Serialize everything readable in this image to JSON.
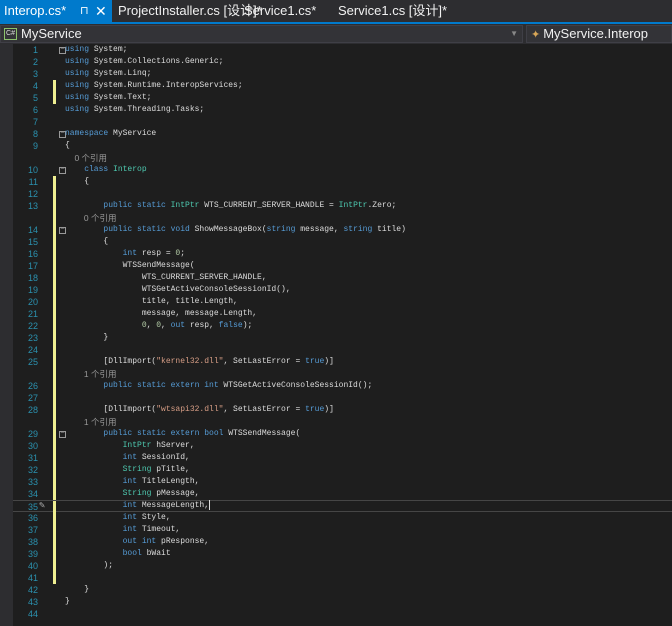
{
  "tabs": [
    {
      "label": "Interop.cs*",
      "active": true
    },
    {
      "label": "ProjectInstaller.cs [设计]*"
    },
    {
      "label": "Service1.cs*"
    },
    {
      "label": "Service1.cs [设计]*"
    }
  ],
  "tab_icons": {
    "pin": "⊓",
    "close": "✕"
  },
  "nav": {
    "project": "MyService",
    "project_icon": "C#",
    "member": "MyService.Interop"
  },
  "colors": {
    "accent": "#007acc",
    "keyword": "#569cd6",
    "type": "#4ec9b0",
    "string": "#d69d85",
    "line_number": "#2b91af"
  },
  "code": {
    "rows": [
      {
        "n": "1",
        "f": 1,
        "tk": [
          [
            "using",
            "k"
          ],
          [
            " System;",
            "p"
          ]
        ]
      },
      {
        "n": "2",
        "tk": [
          [
            "using",
            "k"
          ],
          [
            " System.Collections.Generic;",
            "p"
          ]
        ]
      },
      {
        "n": "3",
        "tk": [
          [
            "using",
            "k"
          ],
          [
            " System.Linq;",
            "p"
          ]
        ]
      },
      {
        "n": "4",
        "c": 1,
        "tk": [
          [
            "using",
            "k"
          ],
          [
            " System.Runtime.InteropServices;",
            "p"
          ]
        ]
      },
      {
        "n": "5",
        "c": 1,
        "tk": [
          [
            "using",
            "k"
          ],
          [
            " System.Text;",
            "p"
          ]
        ]
      },
      {
        "n": "6",
        "tk": [
          [
            "using",
            "k"
          ],
          [
            " System.Threading.Tasks;",
            "p"
          ]
        ]
      },
      {
        "n": "7",
        "tk": []
      },
      {
        "n": "8",
        "f": 1,
        "tk": [
          [
            "namespace",
            "k"
          ],
          [
            " MyService",
            "p"
          ]
        ]
      },
      {
        "n": "9",
        "tk": [
          [
            "{",
            "p"
          ]
        ]
      },
      {
        "n": "",
        "lens": "    0 个引用"
      },
      {
        "n": "10",
        "f": 1,
        "tk": [
          [
            "    class ",
            "k"
          ],
          [
            "Interop",
            "t"
          ]
        ]
      },
      {
        "n": "11",
        "c": 1,
        "tk": [
          [
            "    {",
            "p"
          ]
        ]
      },
      {
        "n": "12",
        "c": 1,
        "tk": []
      },
      {
        "n": "13",
        "c": 1,
        "tk": [
          [
            "        public static ",
            "k"
          ],
          [
            "IntPtr",
            "t"
          ],
          [
            " WTS_CURRENT_SERVER_HANDLE = ",
            "p"
          ],
          [
            "IntPtr",
            "t"
          ],
          [
            ".Zero;",
            "p"
          ]
        ]
      },
      {
        "n": "",
        "c": 1,
        "lens": "        0 个引用"
      },
      {
        "n": "14",
        "c": 1,
        "f": 1,
        "tk": [
          [
            "        public static void",
            "k"
          ],
          [
            " ShowMessageBox(",
            "p"
          ],
          [
            "string",
            "k"
          ],
          [
            " message, ",
            "p"
          ],
          [
            "string",
            "k"
          ],
          [
            " title)",
            "p"
          ]
        ]
      },
      {
        "n": "15",
        "c": 1,
        "tk": [
          [
            "        {",
            "p"
          ]
        ]
      },
      {
        "n": "16",
        "c": 1,
        "tk": [
          [
            "            int",
            "k"
          ],
          [
            " resp = ",
            "p"
          ],
          [
            "0",
            "n"
          ],
          [
            ";",
            "p"
          ]
        ]
      },
      {
        "n": "17",
        "c": 1,
        "tk": [
          [
            "            WTSSendMessage(",
            "p"
          ]
        ]
      },
      {
        "n": "18",
        "c": 1,
        "tk": [
          [
            "                WTS_CURRENT_SERVER_HANDLE,",
            "p"
          ]
        ]
      },
      {
        "n": "19",
        "c": 1,
        "tk": [
          [
            "                WTSGetActiveConsoleSessionId(),",
            "p"
          ]
        ]
      },
      {
        "n": "20",
        "c": 1,
        "tk": [
          [
            "                title, title.Length,",
            "p"
          ]
        ]
      },
      {
        "n": "21",
        "c": 1,
        "tk": [
          [
            "                message, message.Length,",
            "p"
          ]
        ]
      },
      {
        "n": "22",
        "c": 1,
        "tk": [
          [
            "                ",
            "p"
          ],
          [
            "0",
            "n"
          ],
          [
            ", ",
            "p"
          ],
          [
            "0",
            "n"
          ],
          [
            ", ",
            "p"
          ],
          [
            "out",
            "k"
          ],
          [
            " resp, ",
            "p"
          ],
          [
            "false",
            "k"
          ],
          [
            ");",
            "p"
          ]
        ]
      },
      {
        "n": "23",
        "c": 1,
        "tk": [
          [
            "        }",
            "p"
          ]
        ]
      },
      {
        "n": "24",
        "c": 1,
        "tk": []
      },
      {
        "n": "25",
        "c": 1,
        "tk": [
          [
            "        [DllImport(",
            "p"
          ],
          [
            "\"kernel32.dll\"",
            "s"
          ],
          [
            ", SetLastError = ",
            "p"
          ],
          [
            "true",
            "k"
          ],
          [
            ")]",
            "p"
          ]
        ]
      },
      {
        "n": "",
        "c": 1,
        "lens": "        1 个引用"
      },
      {
        "n": "26",
        "c": 1,
        "tk": [
          [
            "        public static extern int",
            "k"
          ],
          [
            " WTSGetActiveConsoleSessionId();",
            "p"
          ]
        ]
      },
      {
        "n": "27",
        "c": 1,
        "tk": []
      },
      {
        "n": "28",
        "c": 1,
        "tk": [
          [
            "        [DllImport(",
            "p"
          ],
          [
            "\"wtsapi32.dll\"",
            "s"
          ],
          [
            ", SetLastError = ",
            "p"
          ],
          [
            "true",
            "k"
          ],
          [
            ")]",
            "p"
          ]
        ]
      },
      {
        "n": "",
        "c": 1,
        "lens": "        1 个引用"
      },
      {
        "n": "29",
        "c": 1,
        "f": 1,
        "tk": [
          [
            "        public static extern bool",
            "k"
          ],
          [
            " WTSSendMessage(",
            "p"
          ]
        ]
      },
      {
        "n": "30",
        "c": 1,
        "tk": [
          [
            "            IntPtr",
            "t"
          ],
          [
            " hServer,",
            "p"
          ]
        ]
      },
      {
        "n": "31",
        "c": 1,
        "tk": [
          [
            "            int",
            "k"
          ],
          [
            " SessionId,",
            "p"
          ]
        ]
      },
      {
        "n": "32",
        "c": 1,
        "tk": [
          [
            "            String",
            "t"
          ],
          [
            " pTitle,",
            "p"
          ]
        ]
      },
      {
        "n": "33",
        "c": 1,
        "tk": [
          [
            "            int",
            "k"
          ],
          [
            " TitleLength,",
            "p"
          ]
        ]
      },
      {
        "n": "34",
        "c": 1,
        "tk": [
          [
            "            String",
            "t"
          ],
          [
            " pMessage,",
            "p"
          ]
        ]
      },
      {
        "n": "35",
        "c": 1,
        "cur": 1,
        "tk": [
          [
            "            int",
            "k"
          ],
          [
            " MessageLength,",
            "p"
          ]
        ]
      },
      {
        "n": "36",
        "c": 1,
        "tk": [
          [
            "            int",
            "k"
          ],
          [
            " Style,",
            "p"
          ]
        ]
      },
      {
        "n": "37",
        "c": 1,
        "tk": [
          [
            "            int",
            "k"
          ],
          [
            " Timeout,",
            "p"
          ]
        ]
      },
      {
        "n": "38",
        "c": 1,
        "tk": [
          [
            "            out int",
            "k"
          ],
          [
            " pResponse,",
            "p"
          ]
        ]
      },
      {
        "n": "39",
        "c": 1,
        "tk": [
          [
            "            bool",
            "k"
          ],
          [
            " bWait",
            "p"
          ]
        ]
      },
      {
        "n": "40",
        "c": 1,
        "tk": [
          [
            "        );",
            "p"
          ]
        ]
      },
      {
        "n": "41",
        "c": 1,
        "tk": []
      },
      {
        "n": "42",
        "tk": [
          [
            "    }",
            "p"
          ]
        ]
      },
      {
        "n": "43",
        "tk": [
          [
            "}",
            "p"
          ]
        ]
      },
      {
        "n": "44",
        "tk": []
      }
    ]
  }
}
